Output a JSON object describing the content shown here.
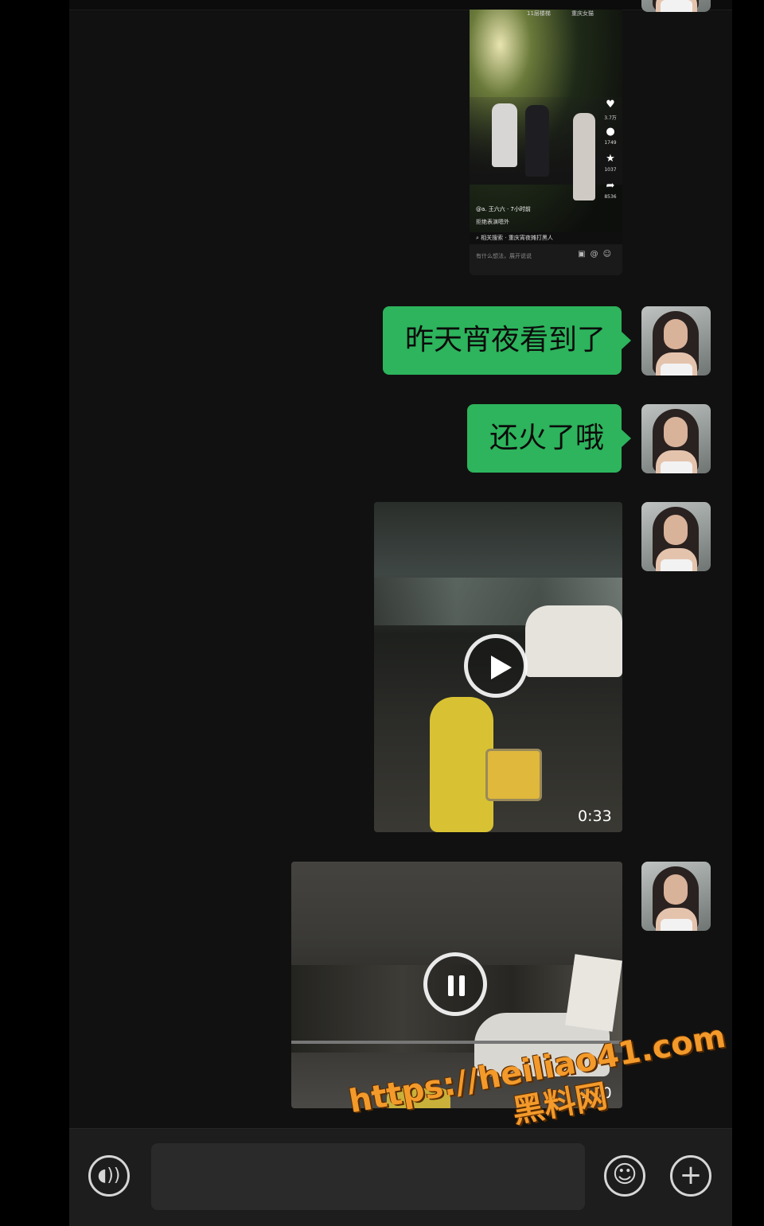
{
  "messages": [
    {
      "type": "image",
      "content": "shared short-video screenshot",
      "shot": {
        "top_left": "11层楼梯",
        "top_right": "重庆女猫",
        "like_count": "3.7万",
        "comment_count": "1749",
        "fav_count": "1037",
        "share_count": "8536",
        "username": "@a. 王六六",
        "time_ago": "· 7小时前",
        "description": "拒绝表演嗯外",
        "search_text": "相关搜索 · 重庆宵夜摊打黑人",
        "input_placeholder": "有什么想法，展开说说"
      }
    },
    {
      "type": "text",
      "text": "昨天宵夜看到了"
    },
    {
      "type": "text",
      "text": "还火了哦"
    },
    {
      "type": "video",
      "duration": "0:33",
      "state": "paused"
    },
    {
      "type": "video",
      "duration": "0:30",
      "state": "playing"
    }
  ],
  "watermark": {
    "line1": "https://heiliao41.com",
    "line2": "黑料网"
  },
  "input": {
    "placeholder": ""
  },
  "colors": {
    "bubble": "#2db45c",
    "background": "#111111",
    "watermark": "#f39a2b"
  }
}
